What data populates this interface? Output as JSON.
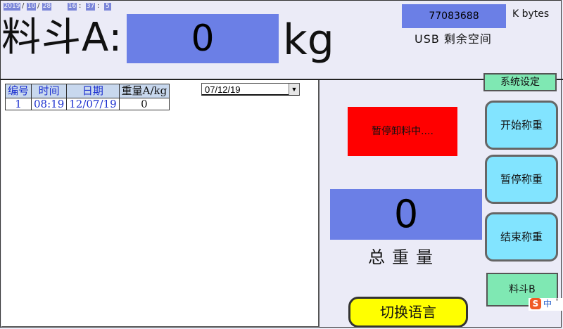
{
  "datetime": {
    "year": "2019",
    "month": "10",
    "day": "28",
    "hour": "16",
    "minute": "37",
    "second": "5",
    "date_sep": "/",
    "time_sep": ":"
  },
  "hopper_a": {
    "label": "料斗A:",
    "value": "0",
    "unit": "kg"
  },
  "usb": {
    "free_space": "77083688",
    "unit": "K bytes",
    "label": "USB 剩余空间"
  },
  "records": {
    "headers": [
      "编号",
      "时间",
      "日期",
      "重量A/kg"
    ],
    "rows": [
      [
        "1",
        "08:19",
        "12/07/19",
        "0"
      ]
    ],
    "date_filter": "07/12/19"
  },
  "buttons": {
    "system_settings": "系统设定",
    "start_weighing": "开始称重",
    "pause_weighing": "暂停称重",
    "end_weighing": "结束称重",
    "hopper_b": "料斗B",
    "switch_language": "切换语言"
  },
  "status": {
    "text": "暂停卸料中....",
    "color": "#ff0000"
  },
  "total": {
    "value": "0",
    "label": "总重量"
  },
  "ime": {
    "logo": "S",
    "mode": "中",
    "dot": "°"
  },
  "colors": {
    "value_box": "#6b7fe6",
    "blue_button": "#82e4ff",
    "green_button": "#7fe8b3",
    "yellow_button": "#ffff00",
    "background": "#ebebf7"
  }
}
